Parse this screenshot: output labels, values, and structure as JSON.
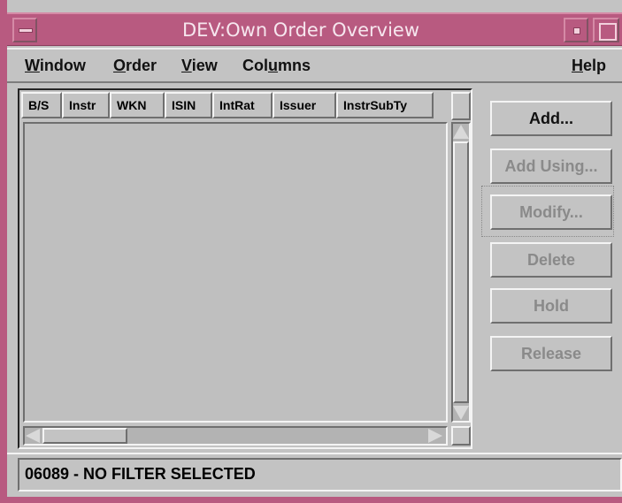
{
  "window": {
    "title": "DEV:Own Order Overview",
    "accent_color": "#b85a80"
  },
  "menubar": {
    "items": [
      {
        "label": "Window",
        "mnemonic": "W"
      },
      {
        "label": "Order",
        "mnemonic": "O"
      },
      {
        "label": "View",
        "mnemonic": "V"
      },
      {
        "label": "Columns",
        "mnemonic": "u"
      },
      {
        "label": "Help",
        "mnemonic": "H"
      }
    ]
  },
  "table": {
    "columns": [
      "B/S",
      "Instr",
      "WKN",
      "ISIN",
      "IntRat",
      "Issuer",
      "InstrSubTy"
    ],
    "rows": []
  },
  "actions": {
    "add": "Add...",
    "add_using": "Add Using...",
    "modify": "Modify...",
    "delete": "Delete",
    "hold": "Hold",
    "release": "Release"
  },
  "status": {
    "text": "06089 - NO FILTER SELECTED"
  }
}
